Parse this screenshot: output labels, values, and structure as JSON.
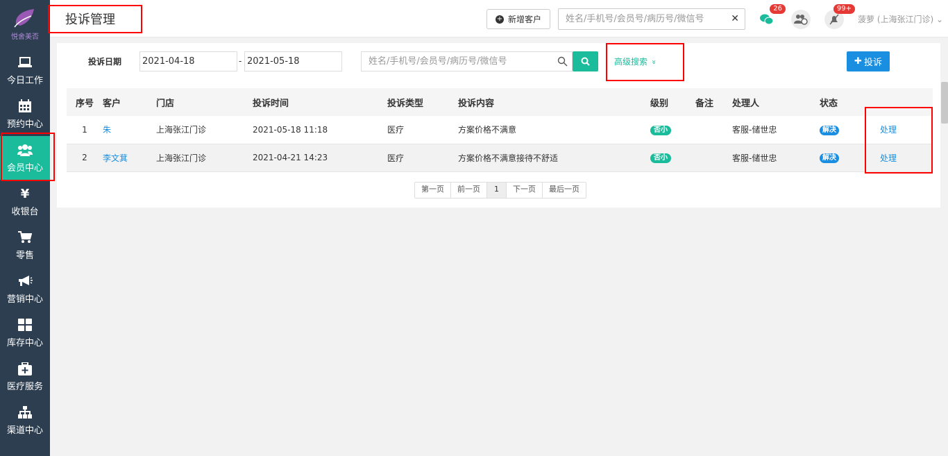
{
  "sidebar": {
    "logo_text": "悦舍美否",
    "items": [
      {
        "label": "今日工作",
        "icon": "laptop-icon"
      },
      {
        "label": "预约中心",
        "icon": "calendar-icon"
      },
      {
        "label": "会员中心",
        "icon": "users-icon",
        "active": true
      },
      {
        "label": "收银台",
        "icon": "yen-icon",
        "glyph": "¥"
      },
      {
        "label": "零售",
        "icon": "cart-icon"
      },
      {
        "label": "营销中心",
        "icon": "megaphone-icon"
      },
      {
        "label": "库存中心",
        "icon": "grid-icon"
      },
      {
        "label": "医疗服务",
        "icon": "medkit-icon"
      },
      {
        "label": "渠道中心",
        "icon": "sitemap-icon"
      }
    ]
  },
  "header": {
    "title": "投诉管理",
    "new_customer_label": "新增客户",
    "search_placeholder": "姓名/手机号/会员号/病历号/微信号",
    "clear_glyph": "✕",
    "wechat_badge": "26",
    "notify_badge": "99+",
    "user_name": "菠萝 (上海张江门诊)",
    "user_caret": "⌄"
  },
  "filter": {
    "date_label": "投诉日期",
    "date_from": "2021-04-18",
    "date_sep": "-",
    "date_to": "2021-05-18",
    "search_placeholder": "姓名/手机号/会员号/病历号/微信号",
    "advanced_label": "高级搜索",
    "advanced_glyph": "»",
    "add_label": "投诉"
  },
  "table": {
    "columns": [
      "序号",
      "客户",
      "门店",
      "投诉时间",
      "投诉类型",
      "投诉内容",
      "级别",
      "备注",
      "处理人",
      "状态",
      ""
    ],
    "rows": [
      {
        "no": "1",
        "customer": "朱",
        "store": "上海张江门诊",
        "time": "2021-05-18 11:18",
        "type": "医疗",
        "content": "方案价格不满意",
        "level": "否小",
        "remark": "",
        "handler": "客服-储世忠",
        "status": "解决",
        "action": "处理"
      },
      {
        "no": "2",
        "customer": "李文萁",
        "store": "上海张江门诊",
        "time": "2021-04-21 14:23",
        "type": "医疗",
        "content": "方案价格不满意接待不舒适",
        "level": "否小",
        "remark": "",
        "handler": "客服-储世忠",
        "status": "解决",
        "action": "处理"
      }
    ]
  },
  "pager": {
    "first": "第一页",
    "prev": "前一页",
    "current": "1",
    "next": "下一页",
    "last": "最后一页"
  },
  "colors": {
    "sidebar_bg": "#2c3e50",
    "accent": "#1abc9c",
    "primary": "#1a8ee0",
    "annotation": "#ff0000"
  }
}
